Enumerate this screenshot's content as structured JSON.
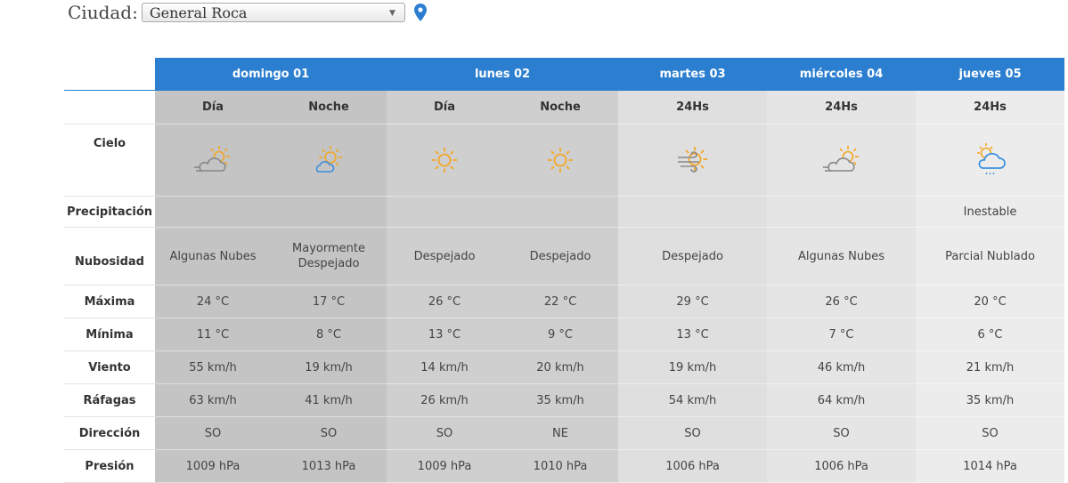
{
  "city": {
    "label": "Ciudad:",
    "selected": "General Roca"
  },
  "days": [
    {
      "name": "domingo 01"
    },
    {
      "name": "lunes 02"
    },
    {
      "name": "martes 03"
    },
    {
      "name": "miércoles 04"
    },
    {
      "name": "jueves 05"
    }
  ],
  "periods": [
    "Día",
    "Noche",
    "Día",
    "Noche",
    "24Hs",
    "24Hs",
    "24Hs"
  ],
  "row_labels": {
    "sky": "Cielo",
    "precip": "Precipitación",
    "cloud": "Nubosidad",
    "max": "Máxima",
    "min": "Mínima",
    "wind": "Viento",
    "gust": "Ráfagas",
    "dir": "Dirección",
    "pres": "Presión"
  },
  "sky_icons": [
    "partly-cloudy-icon",
    "partly-cloudy-night-icon",
    "sun-icon",
    "sun-icon",
    "sun-wind-icon",
    "partly-cloudy-icon",
    "sun-cloud-rain-icon"
  ],
  "precip": [
    "",
    "",
    "",
    "",
    "",
    "",
    "Inestable"
  ],
  "cloud": [
    "Algunas Nubes",
    "Mayormente Despejado",
    "Despejado",
    "Despejado",
    "Despejado",
    "Algunas Nubes",
    "Parcial Nublado"
  ],
  "max": [
    "24 °C",
    "17 °C",
    "26 °C",
    "22 °C",
    "29 °C",
    "26 °C",
    "20 °C"
  ],
  "min": [
    "11 °C",
    "8 °C",
    "13 °C",
    "9 °C",
    "13 °C",
    "7 °C",
    "6 °C"
  ],
  "wind": [
    "55 km/h",
    "19 km/h",
    "14 km/h",
    "20 km/h",
    "19 km/h",
    "46 km/h",
    "21 km/h"
  ],
  "gust": [
    "63 km/h",
    "41 km/h",
    "26 km/h",
    "35 km/h",
    "54 km/h",
    "64 km/h",
    "35 km/h"
  ],
  "dir": [
    "SO",
    "SO",
    "SO",
    "NE",
    "SO",
    "SO",
    "SO"
  ],
  "pres": [
    "1009 hPa",
    "1013 hPa",
    "1009 hPa",
    "1010 hPa",
    "1006 hPa",
    "1006 hPa",
    "1014 hPa"
  ],
  "colors": {
    "header": "#2c7fd0",
    "sun": "#f5a623",
    "cloud_gray": "#888888",
    "cloud_blue": "#3a8fe0",
    "pin": "#2c7fd0"
  }
}
